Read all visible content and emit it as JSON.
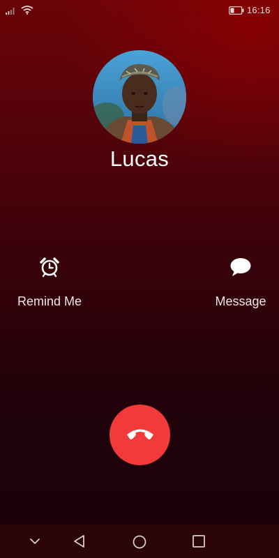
{
  "status_bar": {
    "time": "16:16",
    "icons": [
      "signal-icon",
      "wifi-icon",
      "battery-icon"
    ]
  },
  "call": {
    "contact_name": "Lucas"
  },
  "actions": {
    "remind_label": "Remind Me",
    "message_label": "Message"
  },
  "decline": {
    "icon": "phone-hangup-icon",
    "color": "#f23a3a"
  },
  "nav_bar": {
    "icons": [
      "chevron-down-icon",
      "back-triangle-icon",
      "home-circle-icon",
      "recent-square-icon"
    ]
  },
  "colors": {
    "background_top": "#6b0408",
    "background_bottom": "#180108",
    "nav_bar": "#2a0407"
  }
}
